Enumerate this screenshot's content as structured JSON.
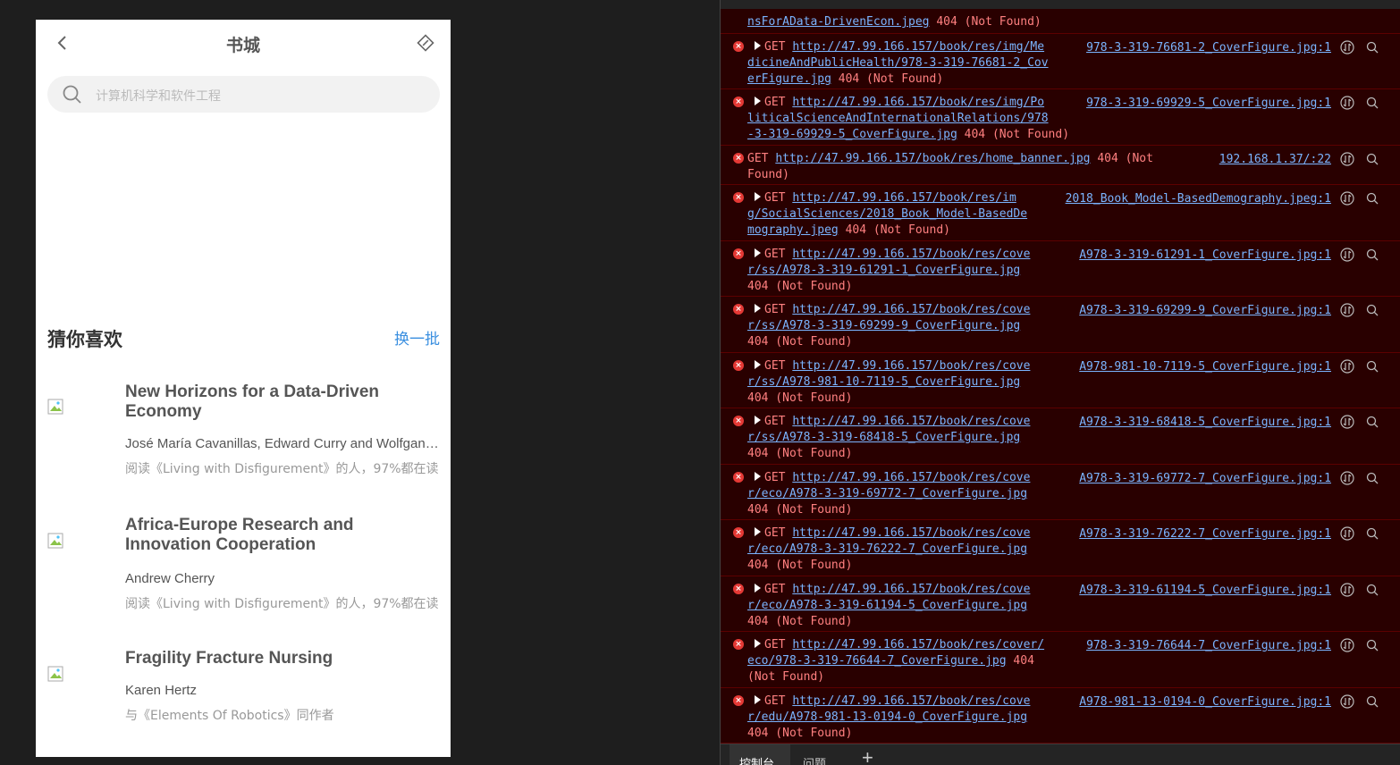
{
  "phone": {
    "nav_title": "书城",
    "search_placeholder": "计算机科学和软件工程",
    "recommend_title": "猜你喜欢",
    "recommend_more": "换一批",
    "books": [
      {
        "title": "New Horizons for a Data-Driven Economy",
        "author": "José María Cavanillas, Edward Curry and Wolfgang Wahlster",
        "related": "阅读《Living with Disfigurement》的人，97%都在读"
      },
      {
        "title": "Africa-Europe Research and Innovation Cooperation",
        "author": "Andrew Cherry",
        "related": "阅读《Living with Disfigurement》的人，97%都在读"
      },
      {
        "title": "Fragility Fracture Nursing",
        "author": "Karen Hertz",
        "related": "与《Elements Of Robotics》同作者"
      }
    ]
  },
  "devtools": {
    "tabs": [
      "控制台",
      "问题"
    ],
    "rows": [
      {
        "line1": "",
        "url_line1": "",
        "url_rest": "nsForAData-DrivenEcon.jpeg",
        "status": "404 (Not Found)",
        "source": "",
        "partial": true
      },
      {
        "url1": "http://47.99.166.157/book/res/img/Me",
        "url2": "dicineAndPublicHealth/978-3-319-76681-2_Cov",
        "url3": "erFigure.jpg",
        "status": "404 (Not Found)",
        "source": "978-3-319-76681-2_CoverFigure.jpg:1"
      },
      {
        "url1": "http://47.99.166.157/book/res/img/Po",
        "url2": "liticalScienceAndInternationalRelations/978",
        "url3": "-3-319-69929-5_CoverFigure.jpg",
        "status": "404 (Not Found)",
        "source": "978-3-319-69929-5_CoverFigure.jpg:1"
      },
      {
        "url1": "http://47.99.166.157/book/res/home_banner.jpg",
        "status1": "404 (Not",
        "status2": "Found)",
        "source": "192.168.1.37/:22"
      },
      {
        "url1": "http://47.99.166.157/book/res/im",
        "url2": "g/SocialSciences/2018_Book_Model-BasedDe",
        "url3": "mography.jpeg",
        "status": "404 (Not Found)",
        "source": "2018_Book_Model-BasedDemography.jpeg:1"
      },
      {
        "url1": "http://47.99.166.157/book/res/cove",
        "url2": "r/ss/A978-3-319-61291-1_CoverFigure.jpg",
        "status": "404 (Not Found)",
        "source": "A978-3-319-61291-1_CoverFigure.jpg:1"
      },
      {
        "url1": "http://47.99.166.157/book/res/cove",
        "url2": "r/ss/A978-3-319-69299-9_CoverFigure.jpg",
        "status": "404 (Not Found)",
        "source": "A978-3-319-69299-9_CoverFigure.jpg:1"
      },
      {
        "url1": "http://47.99.166.157/book/res/cove",
        "url2": "r/ss/A978-981-10-7119-5_CoverFigure.jpg",
        "status": "404 (Not Found)",
        "source": "A978-981-10-7119-5_CoverFigure.jpg:1"
      },
      {
        "url1": "http://47.99.166.157/book/res/cove",
        "url2": "r/ss/A978-3-319-68418-5_CoverFigure.jpg",
        "status": "404 (Not Found)",
        "source": "A978-3-319-68418-5_CoverFigure.jpg:1"
      },
      {
        "url1": "http://47.99.166.157/book/res/cove",
        "url2": "r/eco/A978-3-319-69772-7_CoverFigure.jpg",
        "status": "404 (Not Found)",
        "source": "A978-3-319-69772-7_CoverFigure.jpg:1"
      },
      {
        "url1": "http://47.99.166.157/book/res/cove",
        "url2": "r/eco/A978-3-319-76222-7_CoverFigure.jpg",
        "status": "404 (Not Found)",
        "source": "A978-3-319-76222-7_CoverFigure.jpg:1"
      },
      {
        "url1": "http://47.99.166.157/book/res/cove",
        "url2": "r/eco/A978-3-319-61194-5_CoverFigure.jpg",
        "status": "404 (Not Found)",
        "source": "A978-3-319-61194-5_CoverFigure.jpg:1"
      },
      {
        "url1": "http://47.99.166.157/book/res/cover/",
        "url2": "eco/978-3-319-76644-7_CoverFigure.jpg",
        "status_inline": "404",
        "status_line3": "(Not Found)",
        "source": "978-3-319-76644-7_CoverFigure.jpg:1"
      },
      {
        "url1": "http://47.99.166.157/book/res/cove",
        "url2": "r/edu/A978-981-13-0194-0_CoverFigure.jpg",
        "status": "404 (Not Found)",
        "source": "A978-981-13-0194-0_CoverFigure.jpg:1"
      }
    ],
    "method": "GET"
  }
}
